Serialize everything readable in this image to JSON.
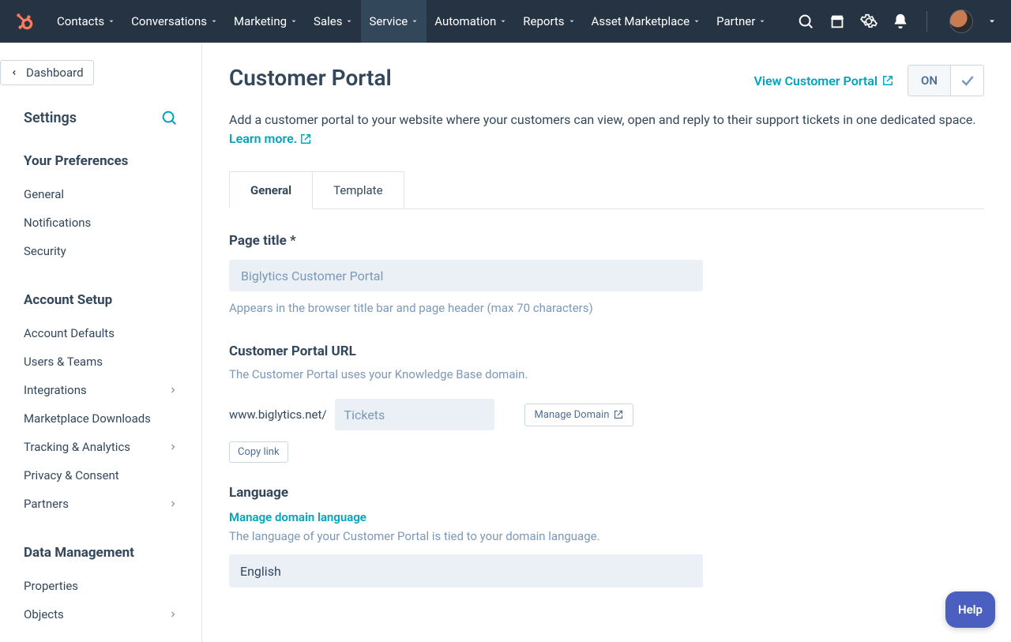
{
  "topnav": {
    "items": [
      {
        "label": "Contacts"
      },
      {
        "label": "Conversations"
      },
      {
        "label": "Marketing"
      },
      {
        "label": "Sales"
      },
      {
        "label": "Service"
      },
      {
        "label": "Automation"
      },
      {
        "label": "Reports"
      },
      {
        "label": "Asset Marketplace"
      },
      {
        "label": "Partner"
      }
    ],
    "active_index": 4
  },
  "back_label": "Dashboard",
  "settings_heading": "Settings",
  "sidebar": {
    "groups": [
      {
        "heading": "Your Preferences",
        "items": [
          {
            "label": "General",
            "expandable": false
          },
          {
            "label": "Notifications",
            "expandable": false
          },
          {
            "label": "Security",
            "expandable": false
          }
        ]
      },
      {
        "heading": "Account Setup",
        "items": [
          {
            "label": "Account Defaults",
            "expandable": false
          },
          {
            "label": "Users & Teams",
            "expandable": false
          },
          {
            "label": "Integrations",
            "expandable": true
          },
          {
            "label": "Marketplace Downloads",
            "expandable": false
          },
          {
            "label": "Tracking & Analytics",
            "expandable": true
          },
          {
            "label": "Privacy & Consent",
            "expandable": false
          },
          {
            "label": "Partners",
            "expandable": true
          }
        ]
      },
      {
        "heading": "Data Management",
        "items": [
          {
            "label": "Properties",
            "expandable": false
          },
          {
            "label": "Objects",
            "expandable": true
          }
        ]
      }
    ]
  },
  "main": {
    "title": "Customer Portal",
    "view_link": "View Customer Portal",
    "toggle_label": "ON",
    "description": "Add a customer portal to your website where your customers can view, open and reply to their support tickets in one dedicated space.  ",
    "learn_more": "Learn more.",
    "tabs": [
      {
        "label": "General"
      },
      {
        "label": "Template"
      }
    ],
    "active_tab": 0,
    "page_title_field": {
      "label": "Page title *",
      "value": "Biglytics Customer Portal",
      "help": "Appears in the browser title bar and page header (max 70 characters)"
    },
    "url_section": {
      "heading": "Customer Portal URL",
      "sub": "The Customer Portal uses your Knowledge Base domain.",
      "prefix": "www.biglytics.net/",
      "slug": "Tickets",
      "manage_btn": "Manage Domain",
      "copy_btn": "Copy link"
    },
    "language_section": {
      "heading": "Language",
      "manage_link": "Manage domain language",
      "sub": "The language of your Customer Portal is tied to your domain language.",
      "selected": "English"
    }
  },
  "help_label": "Help"
}
